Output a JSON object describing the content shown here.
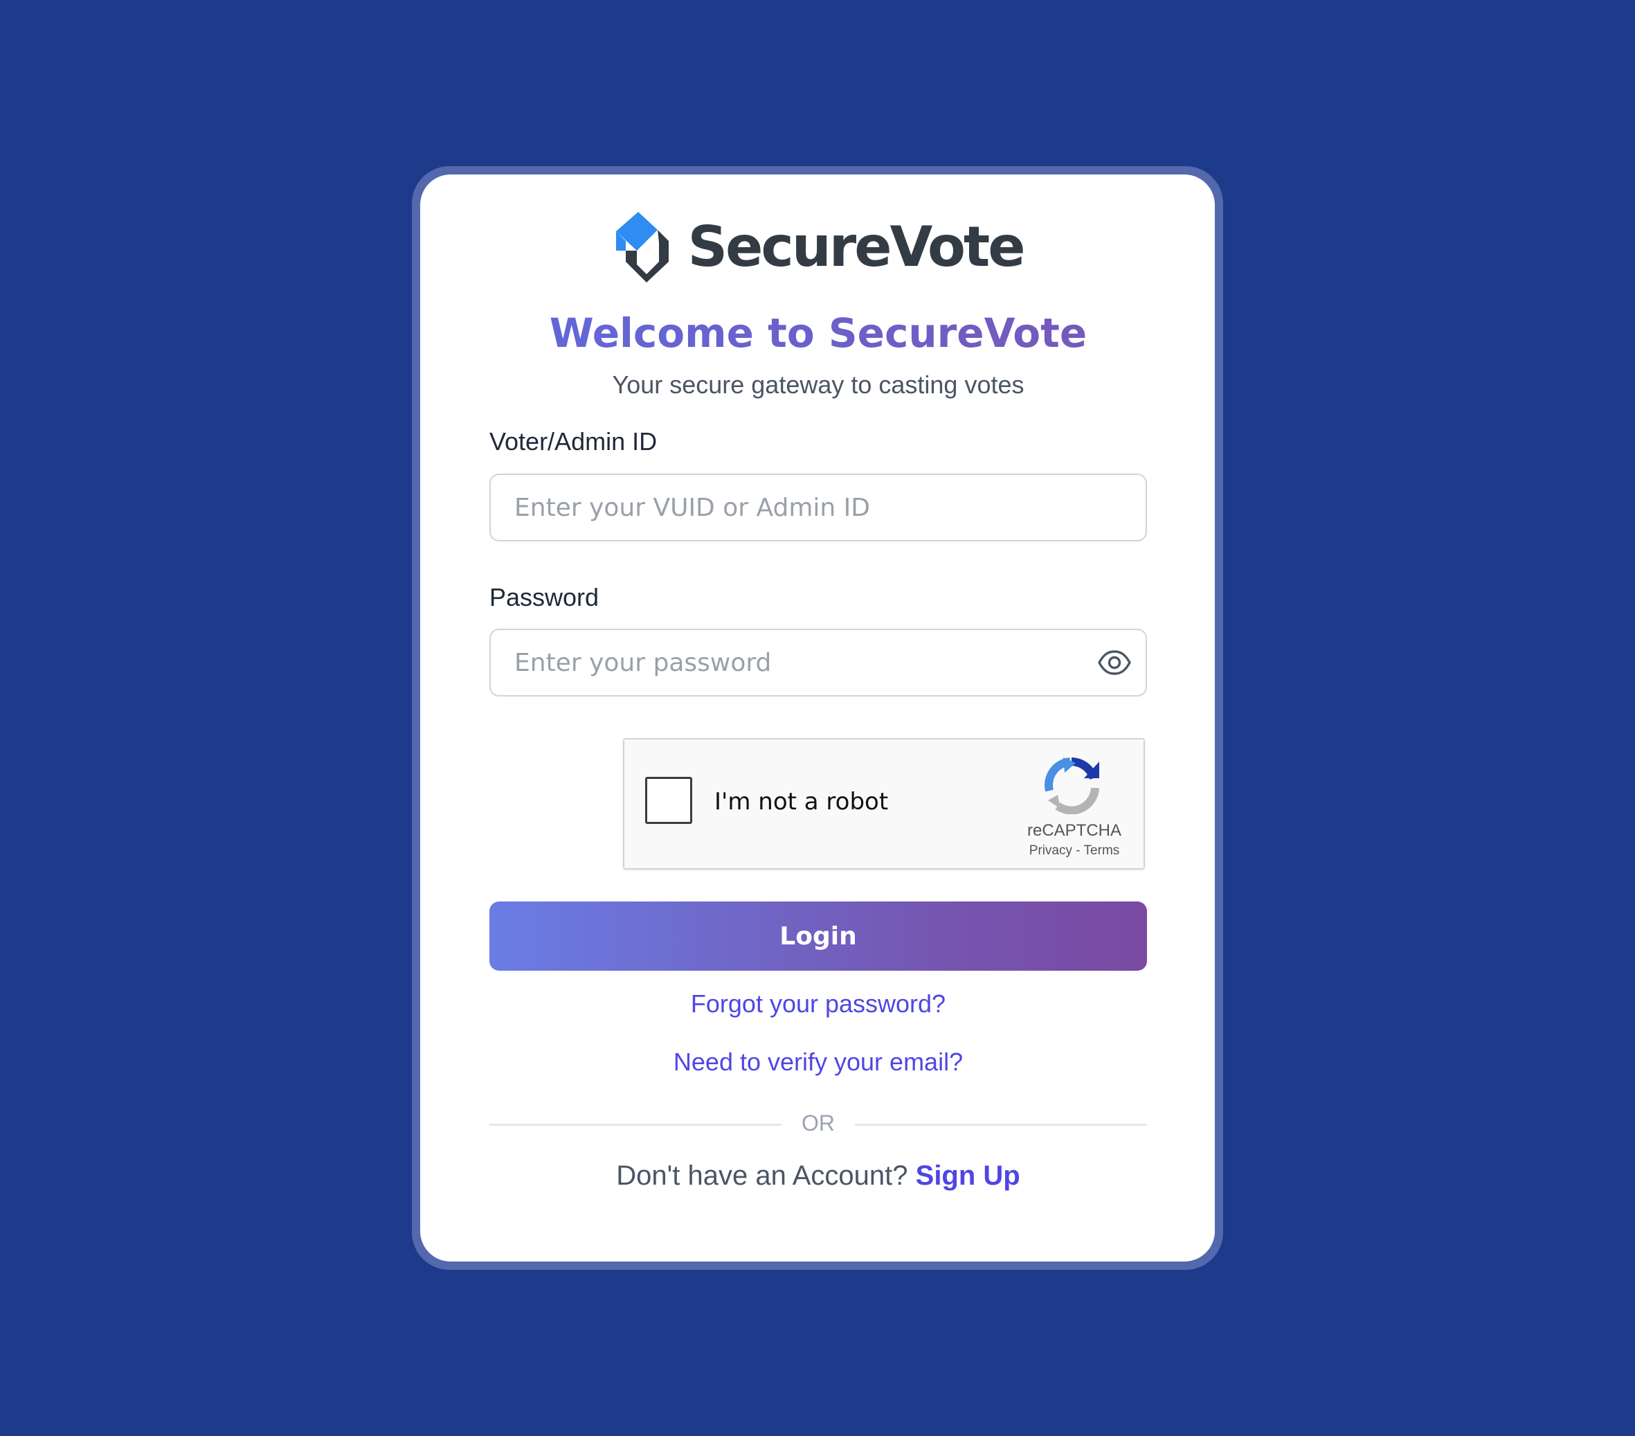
{
  "brand": {
    "name": "SecureVote",
    "colors": {
      "background": "#1e3a8a",
      "accent": "#4f46e5",
      "logo_blue": "#2f8cf0",
      "logo_dark": "#333b45"
    }
  },
  "header": {
    "title": "Welcome to SecureVote",
    "subtitle": "Your secure gateway to casting votes"
  },
  "form": {
    "id_label": "Voter/Admin ID",
    "id_placeholder": "Enter your VUID or Admin ID",
    "id_value": "",
    "password_label": "Password",
    "password_placeholder": "Enter your password",
    "password_value": "",
    "password_toggle_icon": "eye-icon"
  },
  "recaptcha": {
    "label": "I'm not a robot",
    "brand": "reCAPTCHA",
    "privacy": "Privacy",
    "separator": " - ",
    "terms": "Terms",
    "checked": false
  },
  "actions": {
    "login_label": "Login",
    "forgot_password": "Forgot your password?",
    "verify_email": "Need to verify your email?",
    "divider_text": "OR",
    "signup_prompt": "Don't have an Account? ",
    "signup_link": "Sign Up"
  }
}
